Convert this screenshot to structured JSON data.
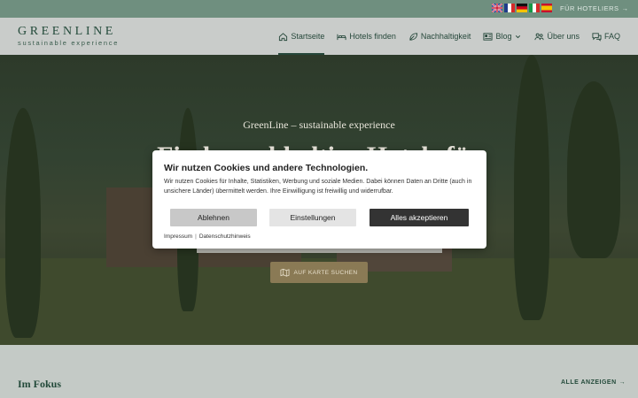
{
  "topbar": {
    "flags": [
      "flag-uk-icon",
      "flag-fr-icon",
      "flag-de-icon",
      "flag-it-icon",
      "flag-es-icon"
    ],
    "hoteliers_label": "FÜR HOTELIERS",
    "hoteliers_arrow": "→"
  },
  "logo": {
    "name": "GREENLINE",
    "tagline": "sustainable experience"
  },
  "nav": {
    "items": [
      {
        "label": "Startseite",
        "icon": "home-icon",
        "active": true
      },
      {
        "label": "Hotels finden",
        "icon": "bed-icon"
      },
      {
        "label": "Nachhaltigkeit",
        "icon": "leaf-icon"
      },
      {
        "label": "Blog",
        "icon": "blog-icon",
        "dropdown": true
      },
      {
        "label": "Über uns",
        "icon": "people-icon"
      },
      {
        "label": "FAQ",
        "icon": "chat-icon"
      }
    ]
  },
  "hero": {
    "subtitle": "GreenLine – sustainable experience",
    "title": "Finde nachhaltige Hotels für",
    "map_button": "AUF KARTE SUCHEN"
  },
  "cookie": {
    "title": "Wir nutzen Cookies und andere Technologien.",
    "text": "Wir nutzen Cookies für Inhalte, Statistiken, Werbung und soziale Medien. Dabei können Daten an Dritte (auch in unsichere Länder) übermittelt werden. Ihre Einwilligung ist freiwillig und widerrufbar.",
    "decline": "Ablehnen",
    "settings": "Einstellungen",
    "accept": "Alles akzeptieren",
    "imprint": "Impressum",
    "separator": "|",
    "privacy": "Datenschutzhinweis"
  },
  "focus": {
    "title": "Im Fokus",
    "all_link": "ALLE ANZEIGEN",
    "all_arrow": "→"
  },
  "colors": {
    "brand": "#234a3a",
    "topbar": "#6f8f7f",
    "accept": "#333333",
    "map_button": "#8a7a55"
  }
}
